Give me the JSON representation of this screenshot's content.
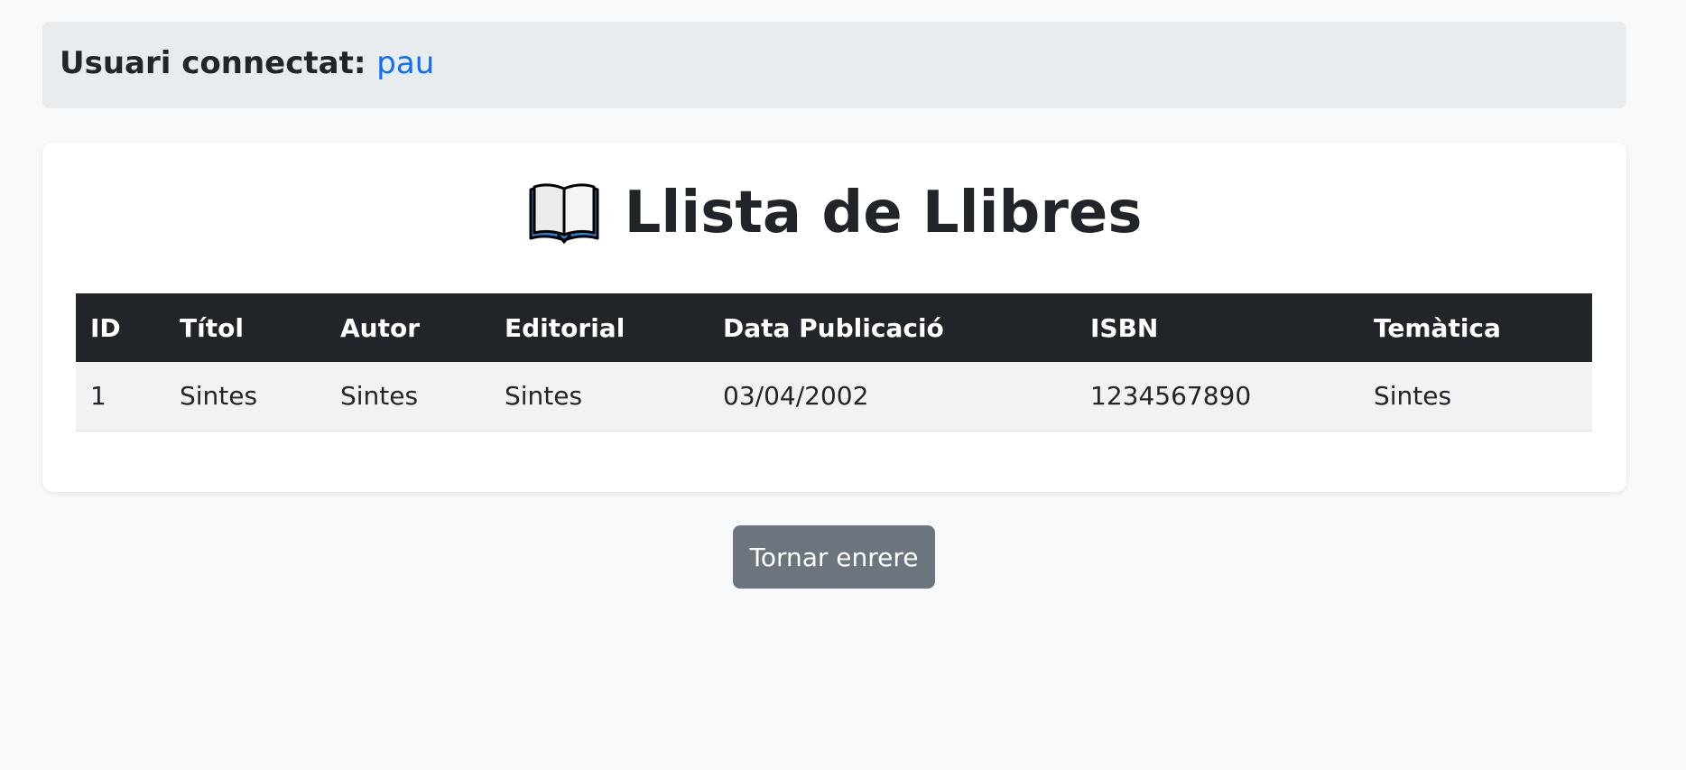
{
  "header": {
    "user_label": "Usuari connectat:",
    "username": "pau"
  },
  "page": {
    "title": "Llista de Llibres",
    "title_icon": "open-book-icon"
  },
  "table": {
    "columns": [
      "ID",
      "Títol",
      "Autor",
      "Editorial",
      "Data Publicació",
      "ISBN",
      "Temàtica"
    ],
    "rows": [
      [
        "1",
        "Sintes",
        "Sintes",
        "Sintes",
        "03/04/2002",
        "1234567890",
        "Sintes"
      ]
    ]
  },
  "actions": {
    "back_label": "Tornar enrere"
  },
  "colors": {
    "link": "#0d6efd",
    "table_header_bg": "#212529",
    "button_bg": "#6c757d"
  }
}
